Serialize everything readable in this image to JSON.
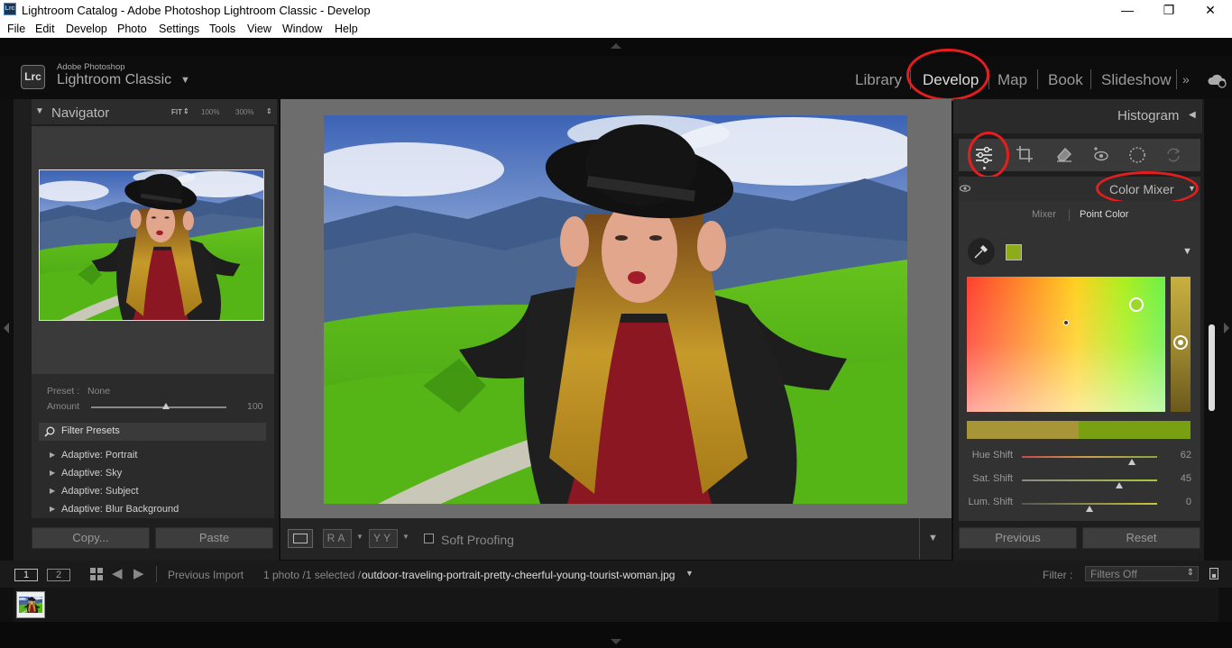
{
  "window": {
    "title": "Lightroom Catalog - Adobe Photoshop Lightroom Classic - Develop",
    "controls": [
      "—",
      "❐",
      "✕"
    ]
  },
  "menu": [
    "File",
    "Edit",
    "Develop",
    "Photo",
    "Settings",
    "Tools",
    "View",
    "Window",
    "Help"
  ],
  "identity": {
    "logo": "Lrc",
    "brand_small": "Adobe Photoshop",
    "brand_large": "Lightroom Classic"
  },
  "modules": [
    "Library",
    "Develop",
    "Map",
    "Book",
    "Slideshow"
  ],
  "active_module": "Develop",
  "navigator": {
    "title": "Navigator",
    "zoom": [
      "FIT",
      "100%",
      "300%"
    ]
  },
  "preset": {
    "label": "Preset :",
    "value": "None",
    "amount_label": "Amount",
    "amount_value": "100",
    "amount_fraction": 0.55
  },
  "presets": {
    "filter_placeholder": "Filter Presets",
    "items": [
      "Adaptive: Portrait",
      "Adaptive: Sky",
      "Adaptive: Subject",
      "Adaptive: Blur Background"
    ]
  },
  "left_buttons": {
    "copy": "Copy...",
    "paste": "Paste"
  },
  "toolbar": {
    "ra": "RA",
    "yy": "YY",
    "soft_proofing": "Soft Proofing"
  },
  "histogram": {
    "title": "Histogram"
  },
  "color_mixer": {
    "title": "Color Mixer",
    "tabs": [
      "Mixer",
      "Point Color"
    ],
    "active_tab": "Point Color",
    "swatch_color": "#8eab1a",
    "sliders": [
      {
        "label": "Hue Shift",
        "value": "62",
        "fraction": 0.81
      },
      {
        "label": "Sat. Shift",
        "value": "45",
        "fraction": 0.72
      },
      {
        "label": "Lum. Shift",
        "value": "0",
        "fraction": 0.5
      }
    ]
  },
  "right_buttons": {
    "previous": "Previous",
    "reset": "Reset"
  },
  "bottom": {
    "pages": [
      "1",
      "2"
    ],
    "source": "Previous Import",
    "count": "1 photo /1 selected /",
    "filename": "outdoor-traveling-portrait-pretty-cheerful-young-tourist-woman.jpg",
    "filter_label": "Filter :",
    "filter_value": "Filters Off"
  },
  "colors": {
    "accent_red": "#e41e1e",
    "panel_bg": "#1e1e1e",
    "center_bg": "#6d6d6d"
  }
}
